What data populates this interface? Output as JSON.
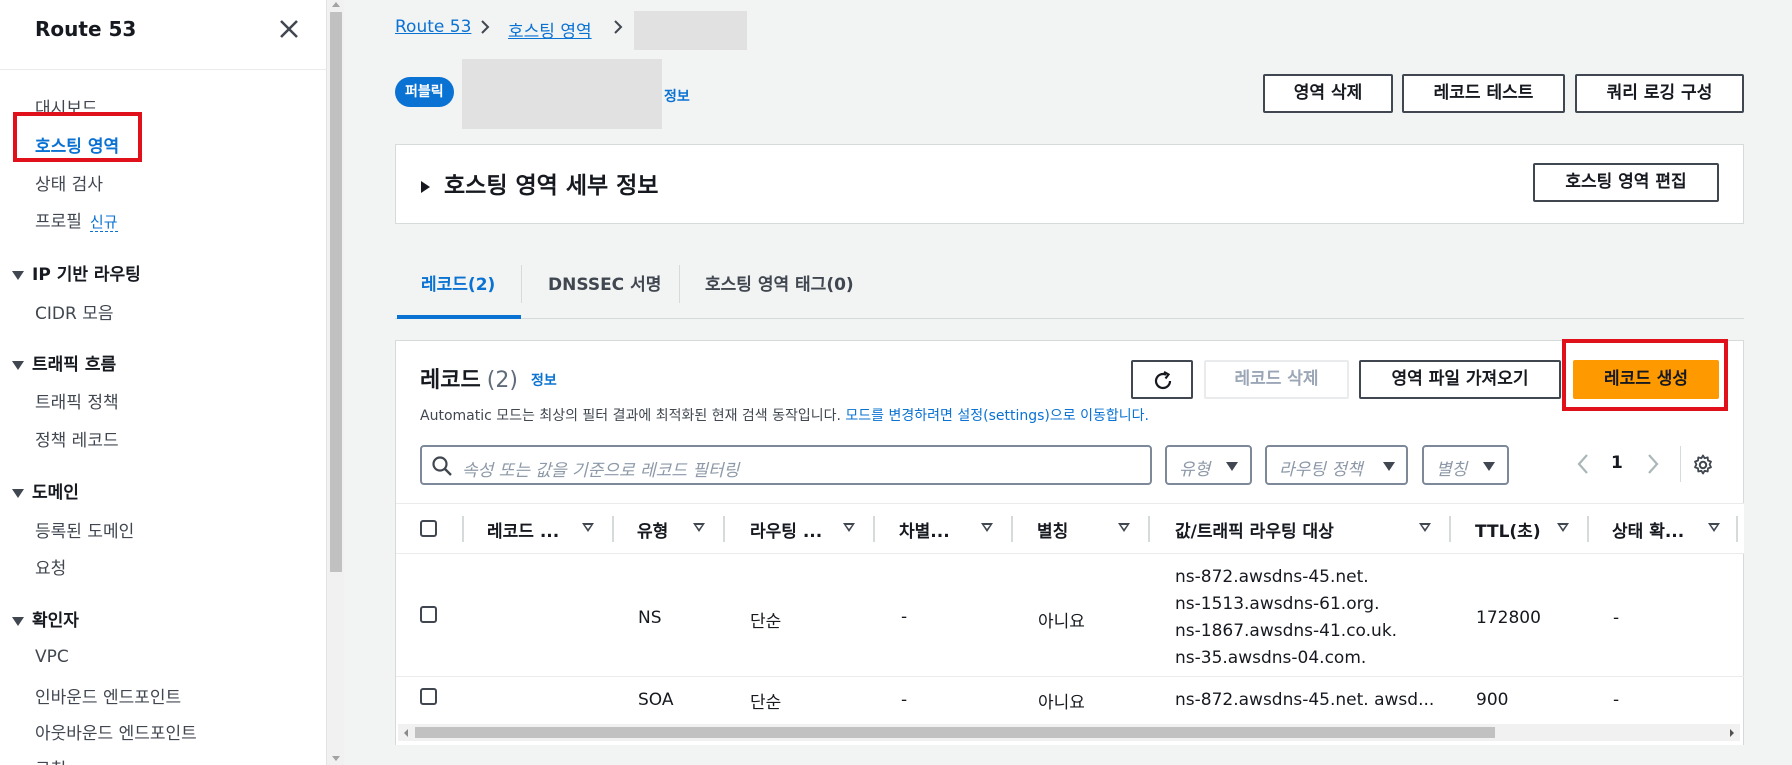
{
  "sidebar": {
    "title": "Route 53",
    "items": {
      "dashboard": "대시보드",
      "hosted_zones": "호스팅 영역",
      "health_checks": "상태 검사",
      "profiles": "프로필",
      "profiles_badge": "신규",
      "cidr": "CIDR 모음",
      "traffic_policies": "트래픽 정책",
      "policy_records": "정책 레코드",
      "registered_domains": "등록된 도메인",
      "requests": "요청",
      "vpc": "VPC",
      "inbound": "인바운드 엔드포인트",
      "outbound": "아웃바운드 엔드포인트",
      "rules": "규칙"
    },
    "sections": {
      "ip_routing": "IP 기반 라우팅",
      "traffic_flow": "트래픽 흐름",
      "domains": "도메인",
      "resolver": "확인자"
    }
  },
  "breadcrumb": {
    "root": "Route 53",
    "hosted_zones": "호스팅 영역"
  },
  "header": {
    "badge": "퍼블릭",
    "info": "정보",
    "delete_zone": "영역 삭제",
    "test_record": "레코드 테스트",
    "query_logging": "쿼리 로깅 구성"
  },
  "details_panel": {
    "title": "호스팅 영역 세부 정보",
    "edit_button": "호스팅 영역 편집"
  },
  "tabs": [
    {
      "label": "레코드(2)"
    },
    {
      "label": "DNSSEC 서명"
    },
    {
      "label": "호스팅 영역 태그(0)"
    }
  ],
  "records": {
    "title": "레코드",
    "count": "(2)",
    "info": "정보",
    "delete_button": "레코드 삭제",
    "import_button": "영역 파일 가져오기",
    "create_button": "레코드 생성",
    "description": "Automatic 모드는 최상의 필터 결과에 최적화된 현재 검색 동작입니다.",
    "description_link": "모드를 변경하려면 설정(settings)으로 이동합니다.",
    "search_placeholder": "속성 또는 값을 기준으로 레코드 필터링",
    "filter_type": "유형",
    "filter_routing": "라우팅 정책",
    "filter_alias": "별칭",
    "page": "1",
    "columns": [
      "레코드 ...",
      "유형",
      "라우팅 ...",
      "차별...",
      "별칭",
      "값/트래픽 라우팅 대상",
      "TTL(초)",
      "상태 확..."
    ],
    "rows": [
      {
        "name": "",
        "type": "NS",
        "routing": "단순",
        "diff": "-",
        "alias": "아니요",
        "values": [
          "ns-872.awsdns-45.net.",
          "ns-1513.awsdns-61.org.",
          "ns-1867.awsdns-41.co.uk.",
          "ns-35.awsdns-04.com."
        ],
        "ttl": "172800",
        "health": "-"
      },
      {
        "name": "",
        "type": "SOA",
        "routing": "단순",
        "diff": "-",
        "alias": "아니요",
        "values": [
          "ns-872.awsdns-45.net. awsd..."
        ],
        "ttl": "900",
        "health": "-"
      }
    ]
  },
  "colors": {
    "accent": "#0972d3",
    "primary_button": "#ff9900",
    "highlight": "#e0111b"
  }
}
